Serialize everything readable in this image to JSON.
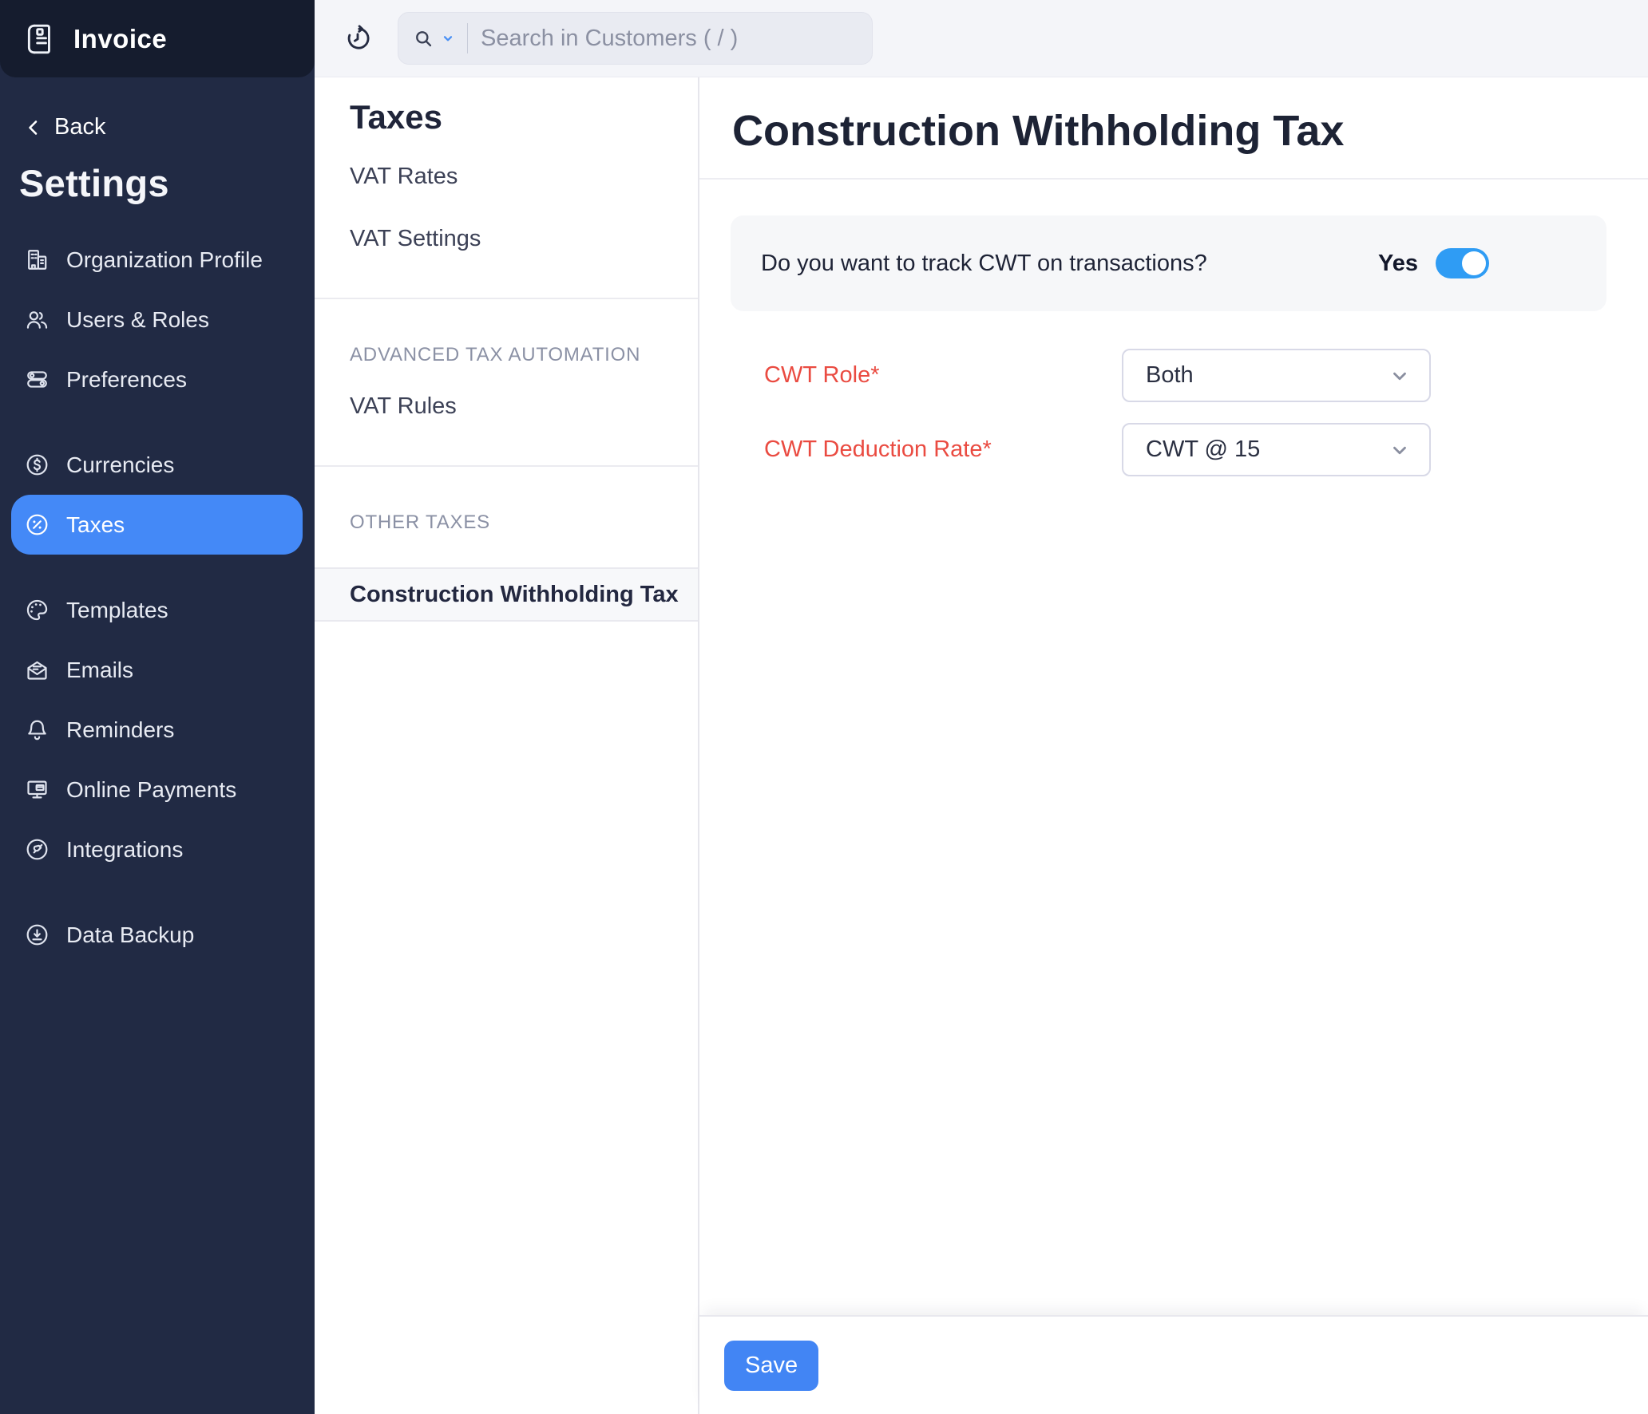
{
  "app": {
    "logo_label": "Invoice"
  },
  "topbar": {
    "search_placeholder": "Search in Customers ( / )"
  },
  "sidebar": {
    "back_label": "Back",
    "title": "Settings",
    "items": [
      {
        "label": "Organization Profile",
        "icon": "building-icon",
        "selected": false
      },
      {
        "label": "Users & Roles",
        "icon": "users-icon",
        "selected": false
      },
      {
        "label": "Preferences",
        "icon": "toggles-icon",
        "selected": false
      },
      {
        "label": "Currencies",
        "icon": "dollar-circle-icon",
        "selected": false
      },
      {
        "label": "Taxes",
        "icon": "percent-circle-icon",
        "selected": true
      },
      {
        "label": "Templates",
        "icon": "palette-icon",
        "selected": false
      },
      {
        "label": "Emails",
        "icon": "envelope-icon",
        "selected": false
      },
      {
        "label": "Reminders",
        "icon": "bell-icon",
        "selected": false
      },
      {
        "label": "Online Payments",
        "icon": "monitor-card-icon",
        "selected": false
      },
      {
        "label": "Integrations",
        "icon": "plug-circle-icon",
        "selected": false
      },
      {
        "label": "Data Backup",
        "icon": "download-circle-icon",
        "selected": false
      }
    ]
  },
  "taxes_panel": {
    "title": "Taxes",
    "groups": [
      {
        "items": [
          "VAT Rates",
          "VAT Settings"
        ]
      },
      {
        "header": "ADVANCED TAX AUTOMATION",
        "items": [
          "VAT Rules"
        ]
      },
      {
        "header": "OTHER TAXES",
        "items": [
          "Construction Withholding Tax"
        ],
        "selected_item": "Construction Withholding Tax"
      }
    ]
  },
  "main": {
    "title": "Construction Withholding Tax",
    "question": "Do you want to track CWT on transactions?",
    "toggle_label": "Yes",
    "toggle_on": true,
    "fields": [
      {
        "label": "CWT Role*",
        "value": "Both",
        "required": true
      },
      {
        "label": "CWT Deduction Rate*",
        "value": "CWT @ 15",
        "required": true
      }
    ],
    "save_label": "Save"
  },
  "colors": {
    "sidebar_bg": "#212A44",
    "sidebar_header_bg": "#151C2E",
    "selected_nav_bg": "#4489F7",
    "toggle_on": "#2F9CF4",
    "save_button": "#4285F4",
    "required_label": "#EA4B41",
    "topbar_bg": "#F4F5F9",
    "panel_bg": "#F6F7F9"
  }
}
